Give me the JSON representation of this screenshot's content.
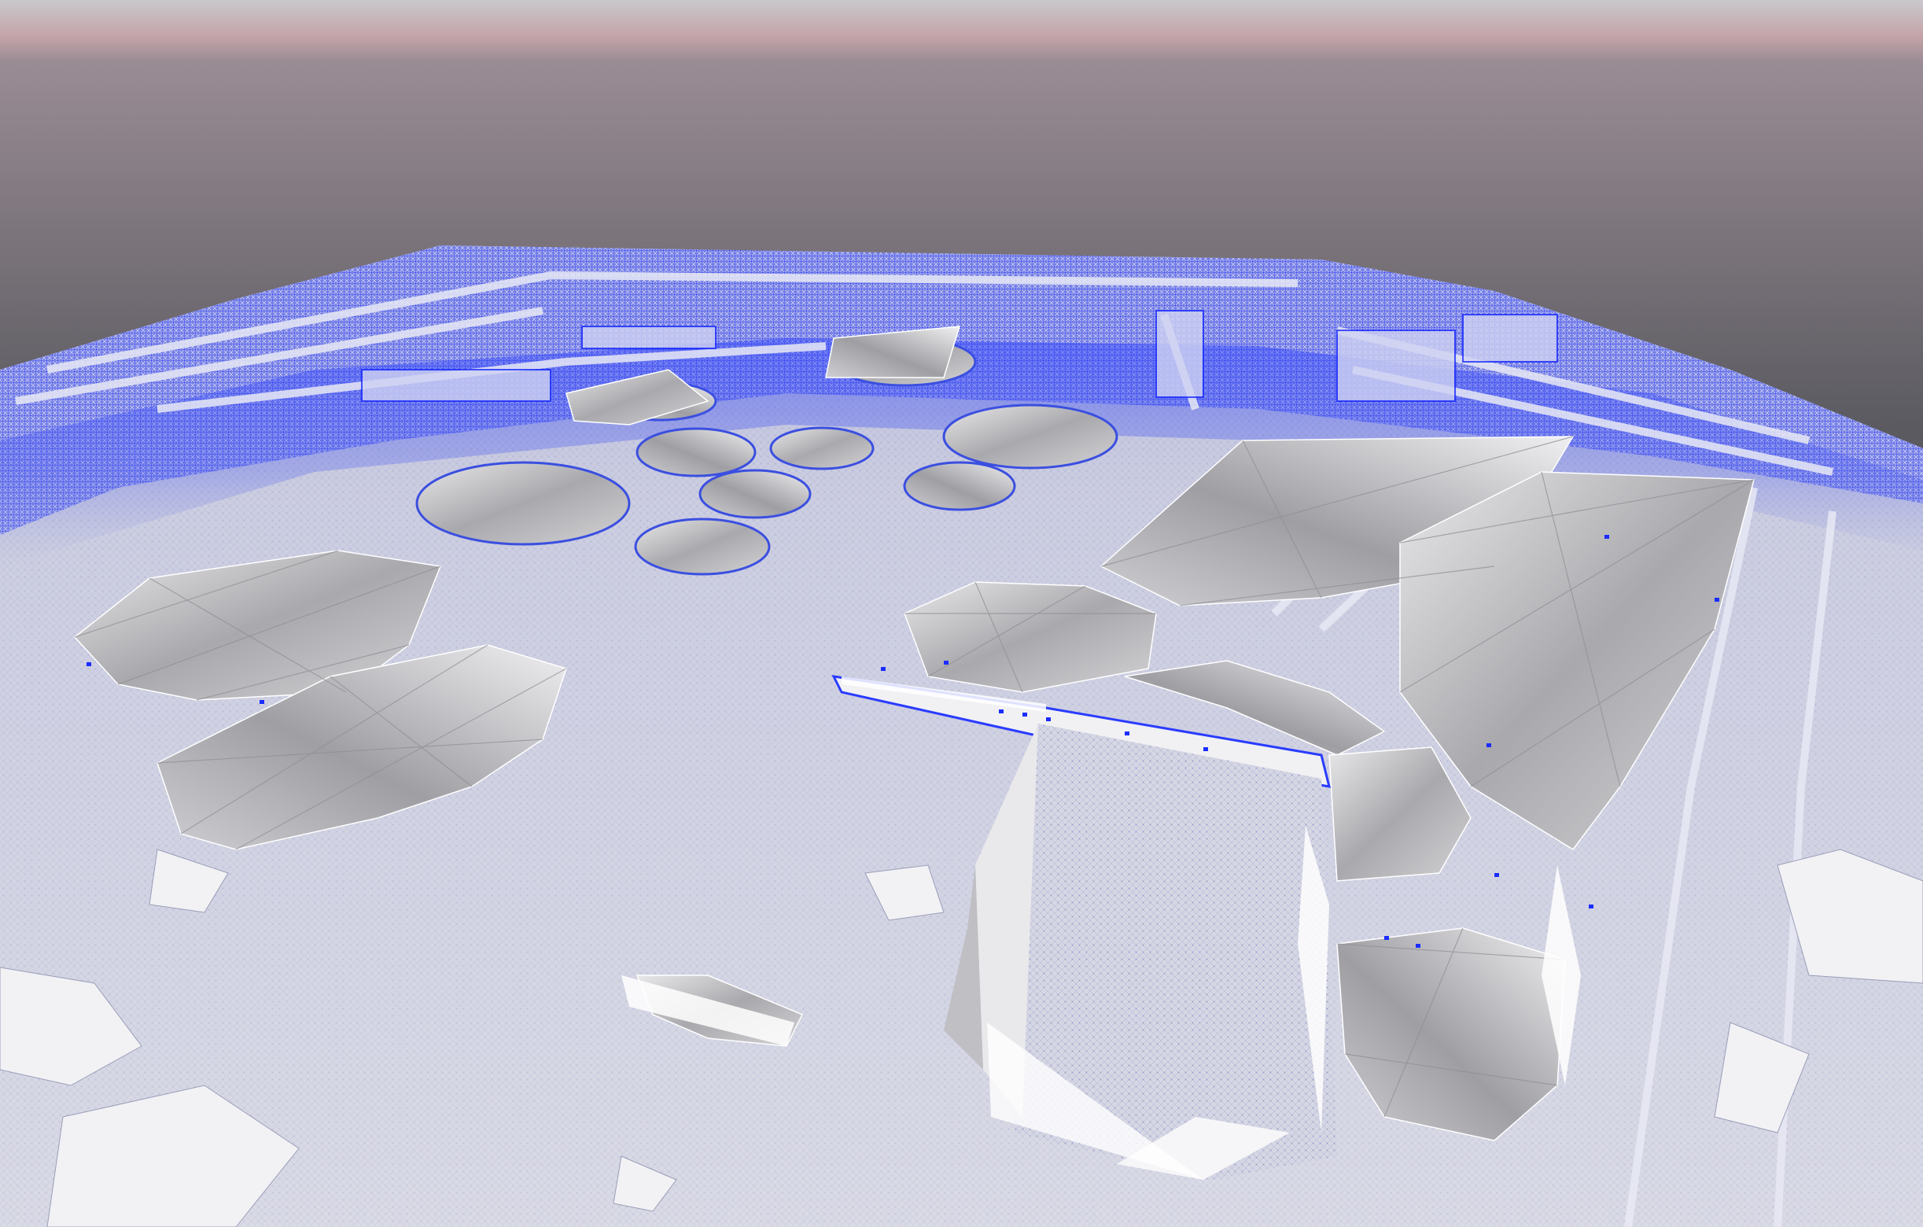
{
  "viewer": {
    "background_top_color": "#c9a3a9",
    "background_horizon_color": "#2f2f33",
    "mesh_surface_color": "#d9dae6",
    "mesh_edge_color": "#1a2cff",
    "flat_facet_color": "#b9b9bd",
    "flat_facet_light_color": "#e6e6e8"
  }
}
